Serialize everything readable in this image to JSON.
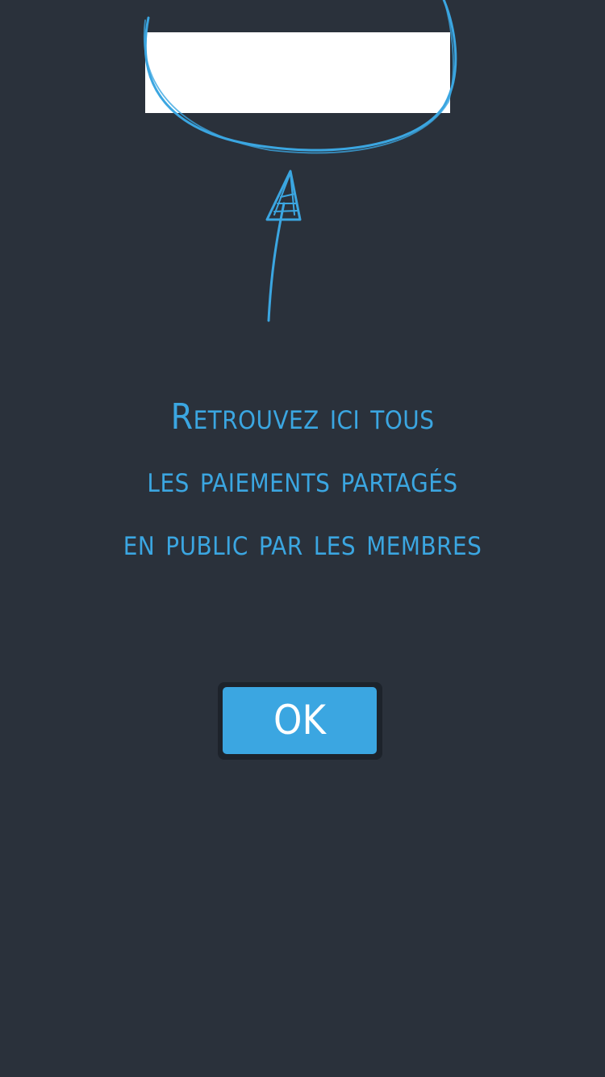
{
  "message": {
    "lines": [
      "Retrouvez ici tous",
      "les paiements partagés",
      "en public par les membres"
    ]
  },
  "ok_button": {
    "label": "OK"
  },
  "colors": {
    "background": "#2a313b",
    "accent": "#3ba6e1",
    "button_text": "#ffffff"
  }
}
